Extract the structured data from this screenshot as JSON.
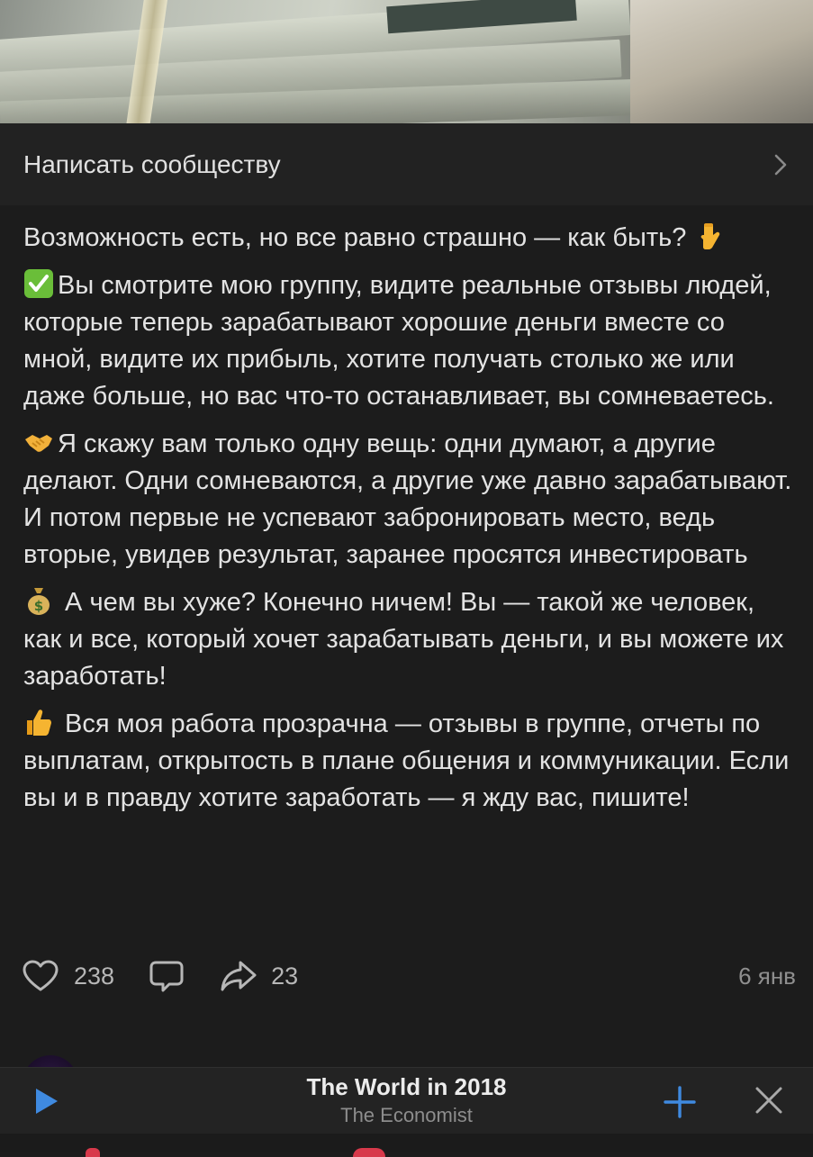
{
  "community_message": {
    "label": "Написать сообществу"
  },
  "post": {
    "paragraphs": [
      {
        "text": "Возможность есть, но все равно страшно — как быть? ",
        "emoji": "pointing-down-emoji",
        "emoji_pos": "end"
      },
      {
        "text": "Вы смотрите мою группу, видите реальные отзывы людей, которые теперь зарабатывают хорошие деньги вместе со мной, видите их прибыль, хотите получать столько же или даже больше, но вас что-то останавливает, вы сомневаетесь.",
        "emoji": "check-mark-emoji",
        "emoji_pos": "start"
      },
      {
        "text": "Я скажу вам только одну вещь: одни думают, а другие делают. Одни сомневаются, а другие уже давно зарабатывают. И потом первые не успевают забронировать место, ведь вторые, увидев результат, заранее просятся инвестировать",
        "emoji": "handshake-emoji",
        "emoji_pos": "start"
      },
      {
        "text": " А чем вы хуже? Конечно ничем! Вы — такой же человек, как и все, который хочет зарабатывать деньги, и вы можете их заработать!",
        "emoji": "money-bag-emoji",
        "emoji_pos": "start"
      },
      {
        "text": " Вся моя работа прозрачна — отзывы в группе, отчеты по выплатам, открытость в плане общения и коммуникации. Если вы и в правду хотите заработать — я жду вас, пишите!",
        "emoji": "thumbs-up-emoji",
        "emoji_pos": "start"
      }
    ],
    "likes": "238",
    "shares": "23",
    "date": "6 янв"
  },
  "player": {
    "title": "The World in 2018",
    "subtitle": "The Economist"
  },
  "colors": {
    "background": "#1c1c1c",
    "accent_blue": "#3f8ae0",
    "text": "#e3e3e3",
    "muted": "#8f8f8f"
  }
}
